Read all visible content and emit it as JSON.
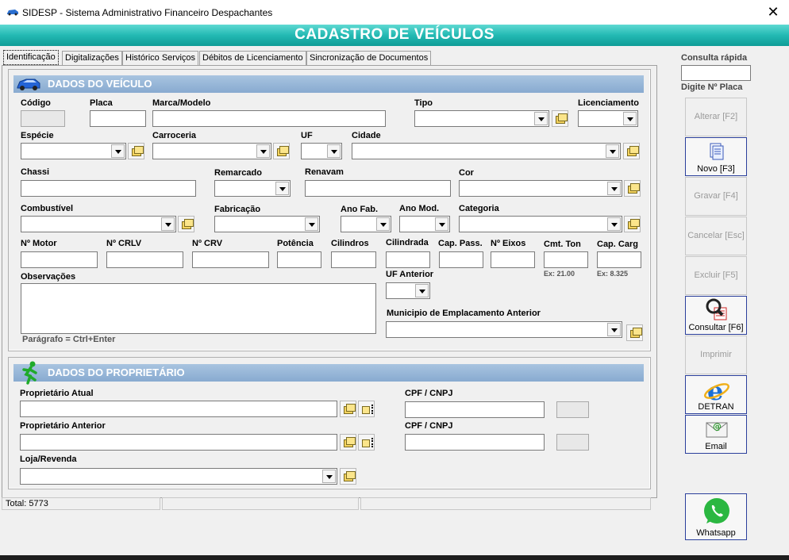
{
  "window": {
    "title": "SIDESP - Sistema Administrativo Financeiro Despachantes",
    "close_glyph": "✕"
  },
  "banner": {
    "title": "CADASTRO  DE  VEÍCULOS"
  },
  "tabs": [
    "Identificação",
    "Digitalizações",
    "Histórico Serviços",
    "Débitos de Licenciamento",
    "Sincronização de Documentos"
  ],
  "vehicle": {
    "section_title": "DADOS DO VEÍCULO",
    "labels": {
      "codigo": "Código",
      "placa": "Placa",
      "marca": "Marca/Modelo",
      "tipo": "Tipo",
      "licenciamento": "Licenciamento",
      "especie": "Espécie",
      "carroceria": "Carroceria",
      "uf": "UF",
      "cidade": "Cidade",
      "chassi": "Chassi",
      "remarcado": "Remarcado",
      "renavam": "Renavam",
      "cor": "Cor",
      "combustivel": "Combustível",
      "fabricacao": "Fabricação",
      "ano_fab": "Ano Fab.",
      "ano_mod": "Ano Mod.",
      "categoria": "Categoria",
      "motor": "Nº Motor",
      "crlv": "Nº CRLV",
      "crv": "Nº CRV",
      "potencia": "Potência",
      "cilindros": "Cilindros",
      "cilindrada": "Cilindrada",
      "cap_pass": "Cap. Pass.",
      "eixos": "Nº Eixos",
      "cmt_ton": "Cmt. Ton",
      "cap_carg": "Cap. Carg",
      "observacoes": "Observações",
      "uf_anterior": "UF Anterior",
      "municipio_anterior": "Municipio de Emplacamento Anterior"
    },
    "hints": {
      "cmt": "Ex: 21.00",
      "carg": "Ex: 8.325",
      "paragrafo": "Parágrafo = Ctrl+Enter"
    }
  },
  "owner": {
    "section_title": "DADOS DO PROPRIETÁRIO",
    "labels": {
      "atual": "Proprietário Atual",
      "anterior": "Proprietário Anterior",
      "cpf": "CPF / CNPJ",
      "loja": "Loja/Revenda"
    }
  },
  "side": {
    "consulta_label": "Consulta rápida",
    "placa_label": "Digite Nº Placa",
    "buttons": {
      "alterar": "Alterar  [F2]",
      "novo": "Novo  [F3]",
      "gravar": "Gravar  [F4]",
      "cancelar": "Cancelar  [Esc]",
      "excluir": "Excluir  [F5]",
      "consultar": "Consultar  [F6]",
      "imprimir": "Imprimir",
      "detran": "DETRAN",
      "email": "Email",
      "whatsapp": "Whatsapp"
    }
  },
  "status": {
    "total": "Total: 5773"
  },
  "colors": {
    "banner": "#23b9b3",
    "section": "#9bb9da",
    "active_border": "#2b3f9c"
  }
}
